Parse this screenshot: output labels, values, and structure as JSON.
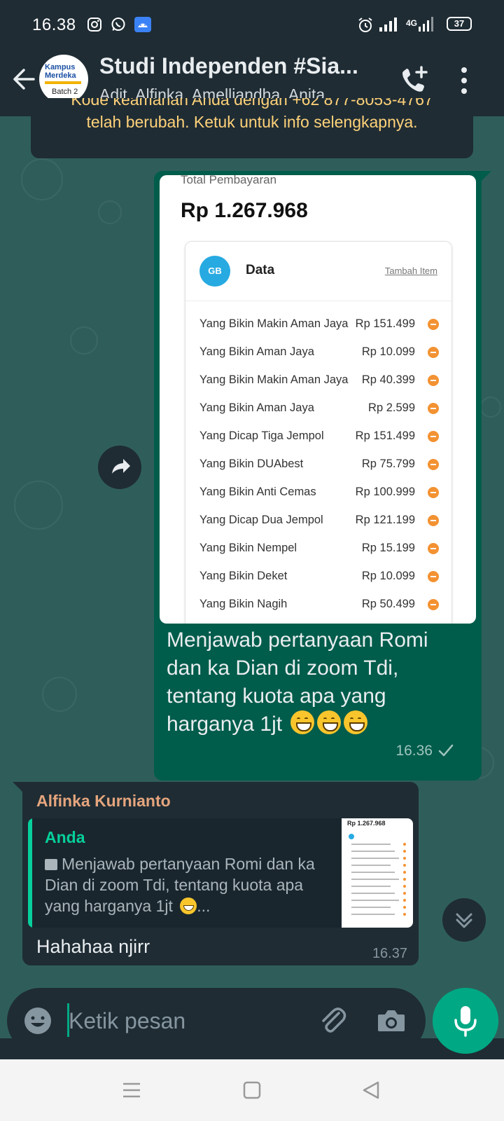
{
  "status_bar": {
    "time": "16.38",
    "network": "4G",
    "battery": "37"
  },
  "header": {
    "avatar_lines": [
      "Kampus",
      "Merdeka",
      "Batch 2"
    ],
    "title": "Studi Independen #Sia...",
    "subtitle": "Adit, Alfinka, Amelliandha, Anita, ..."
  },
  "security_notice": {
    "line1": "Kode keamanan Anda dengan +62 877-8053-4767",
    "line2": "telah berubah. Ketuk untuk info selengkapnya."
  },
  "outgoing_message": {
    "image": {
      "total_label": "Total Pembayaran",
      "total_value": "Rp 1.267.968",
      "card_icon": "GB",
      "card_title": "Data",
      "card_action": "Tambah Item",
      "items": [
        {
          "name": "Yang Bikin Makin Aman Jaya",
          "price": "Rp 151.499"
        },
        {
          "name": "Yang Bikin Aman Jaya",
          "price": "Rp 10.099"
        },
        {
          "name": "Yang Bikin Makin Aman Jaya",
          "price": "Rp 40.399"
        },
        {
          "name": "Yang Bikin Aman Jaya",
          "price": "Rp 2.599"
        },
        {
          "name": "Yang Dicap Tiga Jempol",
          "price": "Rp 151.499"
        },
        {
          "name": "Yang Bikin DUAbest",
          "price": "Rp 75.799"
        },
        {
          "name": "Yang Bikin Anti Cemas",
          "price": "Rp 100.999"
        },
        {
          "name": "Yang Dicap Dua Jempol",
          "price": "Rp 121.199"
        },
        {
          "name": "Yang Bikin Nempel",
          "price": "Rp 15.199"
        },
        {
          "name": "Yang Bikin Deket",
          "price": "Rp 10.099"
        },
        {
          "name": "Yang Bikin Nagih",
          "price": "Rp 50.499"
        }
      ]
    },
    "caption": "Menjawab pertanyaan Romi dan ka Dian di zoom Tdi, tentang kuota apa yang harganya 1jt",
    "emoji": "grinning-face-with-smiling-eyes",
    "time": "16.36",
    "status": "sent-check"
  },
  "incoming_message": {
    "sender": "Alfinka Kurnianto",
    "sender_color": "#e5a57d",
    "quote": {
      "author": "Anda",
      "text": "Menjawab pertanyaan Romi dan ka Dian di zoom Tdi, tentang kuota apa yang harganya 1jt",
      "ellipsis": "...",
      "thumb_total": "Rp 1.267.968"
    },
    "text": "Hahahaa njirr",
    "time": "16.37"
  },
  "composer": {
    "placeholder": "Ketik pesan"
  },
  "colors": {
    "accent": "#00a884",
    "outgoing_bubble": "#005c4b",
    "incoming_bubble": "#1f2c34",
    "header": "#1f2c34",
    "notice_text": "#ffd279"
  }
}
